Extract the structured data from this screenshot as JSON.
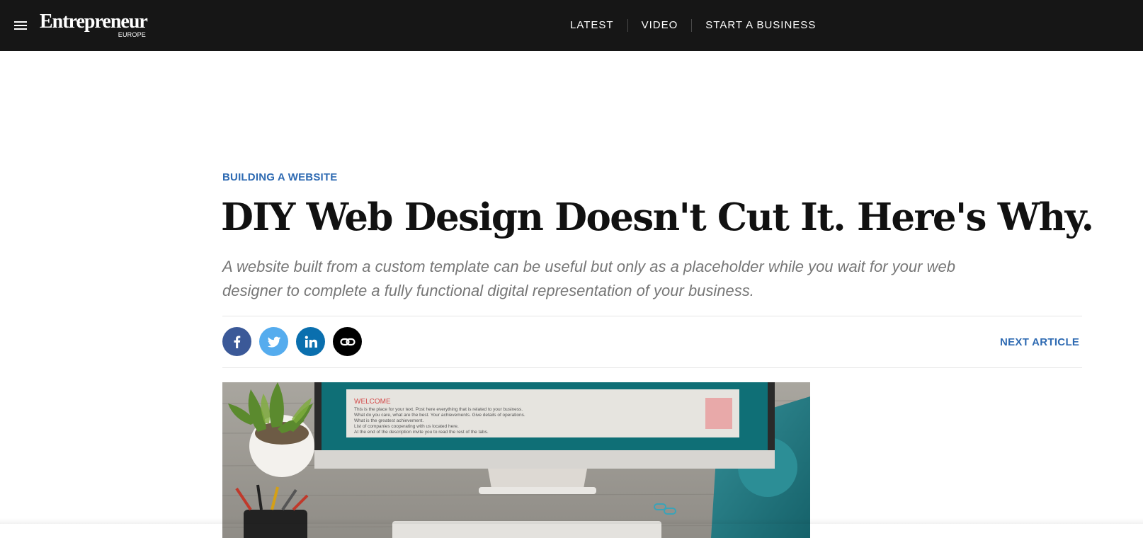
{
  "nav": {
    "menu_icon": "hamburger-icon",
    "logo": {
      "name": "Entrepreneur",
      "edition": "EUROPE"
    },
    "links": [
      {
        "label": "LATEST"
      },
      {
        "label": "VIDEO"
      },
      {
        "label": "START A BUSINESS"
      }
    ]
  },
  "article": {
    "category": "BUILDING A WEBSITE",
    "headline": "DIY Web Design Doesn't Cut It. Here's Why.",
    "dek": "A website built from a custom template can be useful but only as a placeholder while you wait for your web designer to complete a fully functional digital representation of your business.",
    "share": [
      {
        "network": "facebook",
        "icon": "facebook-icon",
        "color": "#3b5998"
      },
      {
        "network": "twitter",
        "icon": "twitter-icon",
        "color": "#55acee"
      },
      {
        "network": "linkedin",
        "icon": "linkedin-icon",
        "color": "#0a6fae"
      },
      {
        "network": "copy-link",
        "icon": "link-icon",
        "color": "#000000"
      }
    ],
    "next_article_label": "NEXT ARTICLE",
    "hero_image": {
      "screen_heading": "WELCOME",
      "screen_lines": [
        "This is the place for your text. Post here everything that is related to your business.",
        "What do you care, what are the best. Your achievements. Give details of operations.",
        "What is the greatest achievement.",
        "List of companies cooperating with us located here.",
        "At the end of the description invite you to read the rest of the tabs."
      ]
    }
  },
  "colors": {
    "topbar": "#161616",
    "accent": "#2e6ab2",
    "headline": "#111111",
    "dek": "#777777"
  }
}
